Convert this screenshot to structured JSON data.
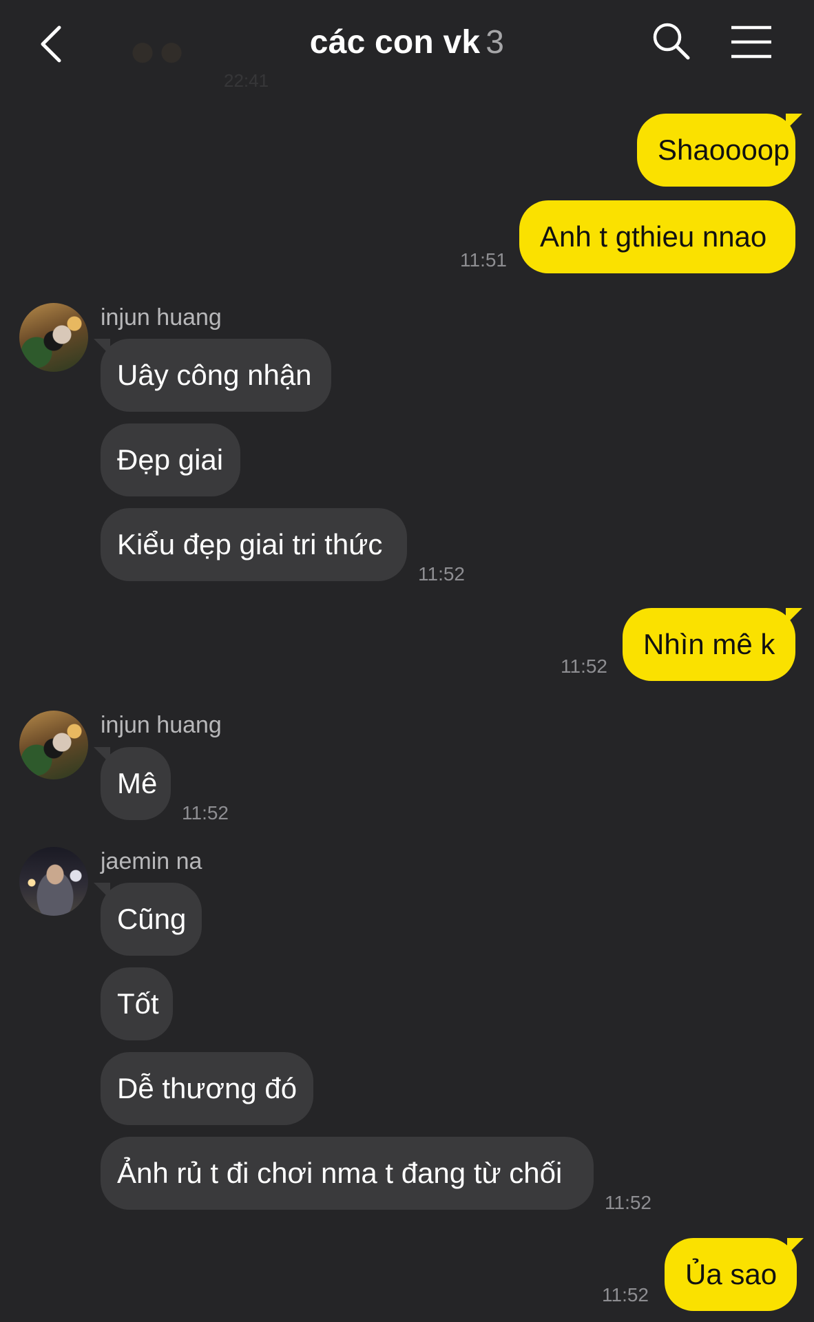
{
  "header": {
    "title": "các con vk",
    "member_count": "3",
    "back_icon": "chevron-left-icon",
    "search_icon": "search-icon",
    "menu_icon": "hamburger-menu-icon",
    "bg_thumb_time": "22:41"
  },
  "colors": {
    "background": "#252527",
    "outgoing_bubble": "#fae100",
    "incoming_bubble": "#3a3a3c",
    "timestamp": "#8e8e92"
  },
  "messages": {
    "m1": "Shaoooop",
    "m2": "Anh t gthieu nnao",
    "t2": "11:51",
    "n1": "injun huang",
    "m3": "Uây công nhận",
    "m4": "Đẹp giai",
    "m5": "Kiểu đẹp giai tri thức",
    "t5": "11:52",
    "m6": "Nhìn mê k",
    "t6": "11:52",
    "n2": "injun huang",
    "m7": "Mê",
    "t7": "11:52",
    "n3": "jaemin na",
    "m8": "Cũng",
    "m9": "Tốt",
    "m10": "Dễ thương đó",
    "m11": "Ảnh rủ t đi chơi nma t đang từ chối",
    "t11": "11:52",
    "m12": "Ủa sao",
    "t12": "11:52"
  }
}
